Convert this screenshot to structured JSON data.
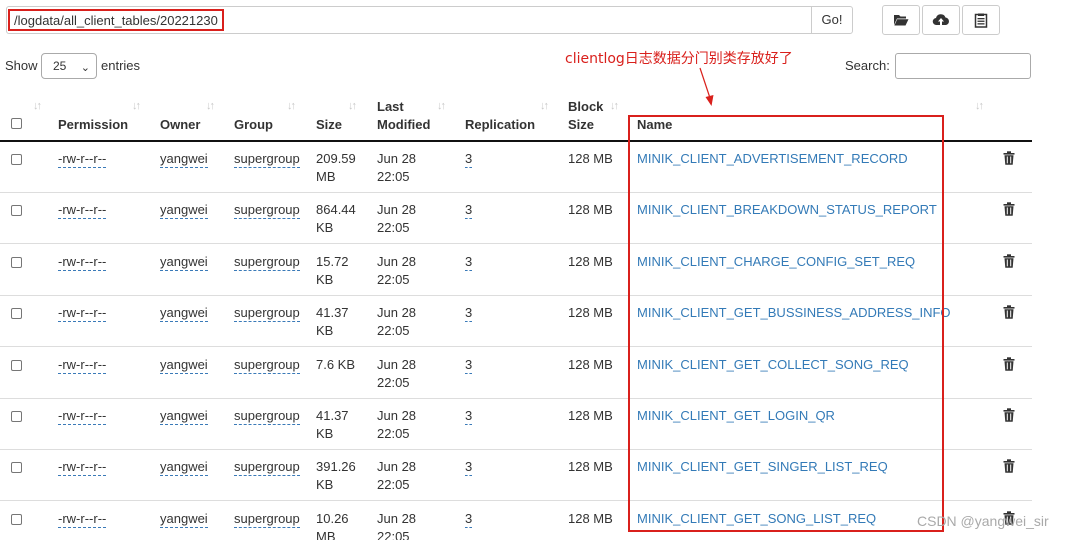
{
  "toolbar": {
    "path_value": "/logdata/all_client_tables/20221230",
    "go_label": "Go!",
    "icons": [
      "folder-open-icon",
      "cloud-upload-icon",
      "clipboard-icon"
    ]
  },
  "controls": {
    "show_label": "Show",
    "entries_value": "25",
    "entries_label": "entries",
    "search_label": "Search:",
    "search_value": ""
  },
  "annotation": {
    "text": "clientlog日志数据分门别类存放好了",
    "color": "#d9201c"
  },
  "table": {
    "headers": {
      "permission": "Permission",
      "owner": "Owner",
      "group": "Group",
      "size": "Size",
      "last_modified_1": "Last",
      "last_modified_2": "Modified",
      "replication": "Replication",
      "block_size_1": "Block",
      "block_size_2": "Size",
      "name": "Name"
    },
    "rows": [
      {
        "permission": "-rw-r--r--",
        "owner": "yangwei",
        "group": "supergroup",
        "size_1": "209.59",
        "size_2": "MB",
        "date_1": "Jun 28",
        "date_2": "22:05",
        "replication": "3",
        "block_size": "128 MB",
        "name": "MINIK_CLIENT_ADVERTISEMENT_RECORD"
      },
      {
        "permission": "-rw-r--r--",
        "owner": "yangwei",
        "group": "supergroup",
        "size_1": "864.44",
        "size_2": "KB",
        "date_1": "Jun 28",
        "date_2": "22:05",
        "replication": "3",
        "block_size": "128 MB",
        "name": "MINIK_CLIENT_BREAKDOWN_STATUS_REPORT"
      },
      {
        "permission": "-rw-r--r--",
        "owner": "yangwei",
        "group": "supergroup",
        "size_1": "15.72",
        "size_2": "KB",
        "date_1": "Jun 28",
        "date_2": "22:05",
        "replication": "3",
        "block_size": "128 MB",
        "name": "MINIK_CLIENT_CHARGE_CONFIG_SET_REQ"
      },
      {
        "permission": "-rw-r--r--",
        "owner": "yangwei",
        "group": "supergroup",
        "size_1": "41.37",
        "size_2": "KB",
        "date_1": "Jun 28",
        "date_2": "22:05",
        "replication": "3",
        "block_size": "128 MB",
        "name": "MINIK_CLIENT_GET_BUSSINESS_ADDRESS_INFO"
      },
      {
        "permission": "-rw-r--r--",
        "owner": "yangwei",
        "group": "supergroup",
        "size_1": "7.6 KB",
        "size_2": "",
        "date_1": "Jun 28",
        "date_2": "22:05",
        "replication": "3",
        "block_size": "128 MB",
        "name": "MINIK_CLIENT_GET_COLLECT_SONG_REQ"
      },
      {
        "permission": "-rw-r--r--",
        "owner": "yangwei",
        "group": "supergroup",
        "size_1": "41.37",
        "size_2": "KB",
        "date_1": "Jun 28",
        "date_2": "22:05",
        "replication": "3",
        "block_size": "128 MB",
        "name": "MINIK_CLIENT_GET_LOGIN_QR"
      },
      {
        "permission": "-rw-r--r--",
        "owner": "yangwei",
        "group": "supergroup",
        "size_1": "391.26",
        "size_2": "KB",
        "date_1": "Jun 28",
        "date_2": "22:05",
        "replication": "3",
        "block_size": "128 MB",
        "name": "MINIK_CLIENT_GET_SINGER_LIST_REQ"
      },
      {
        "permission": "-rw-r--r--",
        "owner": "yangwei",
        "group": "supergroup",
        "size_1": "10.26",
        "size_2": "MB",
        "date_1": "Jun 28",
        "date_2": "22:05",
        "replication": "3",
        "block_size": "128 MB",
        "name": "MINIK_CLIENT_GET_SONG_LIST_REQ"
      }
    ]
  },
  "watermark": "CSDN @yangwei_sir"
}
